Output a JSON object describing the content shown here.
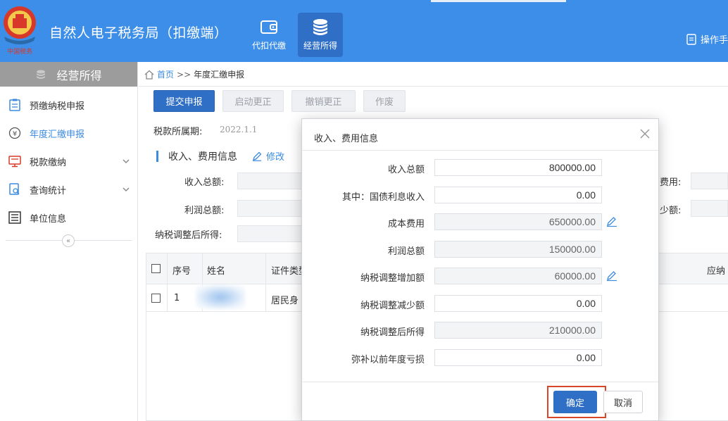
{
  "header": {
    "app_title": "自然人电子税务局（扣缴端）",
    "nav": [
      {
        "label": "代扣代缴",
        "icon": "wallet-icon"
      },
      {
        "label": "经营所得",
        "icon": "coins-icon"
      }
    ],
    "manual_label": "操作手"
  },
  "sidebar": {
    "title": "经营所得",
    "items": [
      {
        "label": "预缴纳税申报",
        "icon": "clipboard-icon"
      },
      {
        "label": "年度汇缴申报",
        "icon": "yen-icon"
      },
      {
        "label": "税款缴纳",
        "icon": "monitor-icon"
      },
      {
        "label": "查询统计",
        "icon": "search-doc-icon"
      },
      {
        "label": "单位信息",
        "icon": "list-icon"
      }
    ],
    "collapse_symbol": "«"
  },
  "breadcrumb": {
    "home": "首页",
    "sep": ">>",
    "current": "年度汇缴申报"
  },
  "toolbar": {
    "submit": "提交申报",
    "start_correction": "启动更正",
    "cancel_correction": "撤销更正",
    "void": "作废"
  },
  "period": {
    "label": "税款所属期:",
    "value": "2022.1.1"
  },
  "section": {
    "title": "收入、费用信息",
    "edit": "修改"
  },
  "form": {
    "income_total": "收入总额:",
    "profit_total": "利润总额:",
    "taxable_after_adj": "纳税调整后所得:",
    "expense_partial": "费用:",
    "decrease_partial": "少额:"
  },
  "table": {
    "headers": [
      "序号",
      "姓名",
      "证件类型",
      "应纳"
    ],
    "rows": [
      {
        "no": "1",
        "id_type": "居民身"
      }
    ]
  },
  "modal": {
    "title": "收入、费用信息",
    "rows": [
      {
        "label": "收入总额",
        "value": "800000.00",
        "readonly": false
      },
      {
        "label": "其中：国债利息收入",
        "value": "0.00",
        "readonly": false
      },
      {
        "label": "成本费用",
        "value": "650000.00",
        "readonly": true,
        "editable_icon": true
      },
      {
        "label": "利润总额",
        "value": "150000.00",
        "readonly": true
      },
      {
        "label": "纳税调整增加额",
        "value": "60000.00",
        "readonly": true,
        "editable_icon": true
      },
      {
        "label": "纳税调整减少额",
        "value": "0.00",
        "readonly": false
      },
      {
        "label": "纳税调整后所得",
        "value": "210000.00",
        "readonly": true
      },
      {
        "label": "弥补以前年度亏损",
        "value": "0.00",
        "readonly": false
      }
    ],
    "ok": "确定",
    "cancel": "取消"
  },
  "colors": {
    "header_bg": "#3d8ee8",
    "primary": "#2f6fc6",
    "highlight_frame": "#d9472b",
    "link": "#3b8be0"
  }
}
